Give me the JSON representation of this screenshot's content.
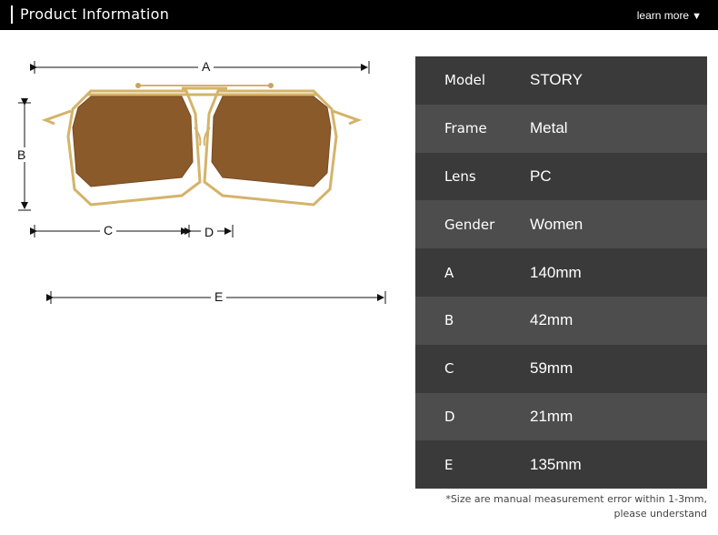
{
  "header": {
    "title": "Product Information",
    "learn_more": "learn more",
    "arrow_icon": "triangle-down-icon"
  },
  "dimensions": {
    "a": "A",
    "b": "B",
    "c": "C",
    "d": "D",
    "e": "E"
  },
  "specs": [
    {
      "key": "Model",
      "value": "STORY"
    },
    {
      "key": "Frame",
      "value": "Metal"
    },
    {
      "key": "Lens",
      "value": "PC"
    },
    {
      "key": "Gender",
      "value": "Women"
    },
    {
      "key": "A",
      "value": "140mm"
    },
    {
      "key": "B",
      "value": "42mm"
    },
    {
      "key": "C",
      "value": "59mm"
    },
    {
      "key": "D",
      "value": "21mm"
    },
    {
      "key": "E",
      "value": "135mm"
    }
  ],
  "note": {
    "line1": "*Size are manual measurement error within 1-3mm,",
    "line2": "please understand"
  },
  "colors": {
    "frame_gold": "#d4b36a",
    "lens_brown": "#8a5a2b",
    "row_dark": "#3a3a3a",
    "row_light": "#4d4d4d"
  }
}
